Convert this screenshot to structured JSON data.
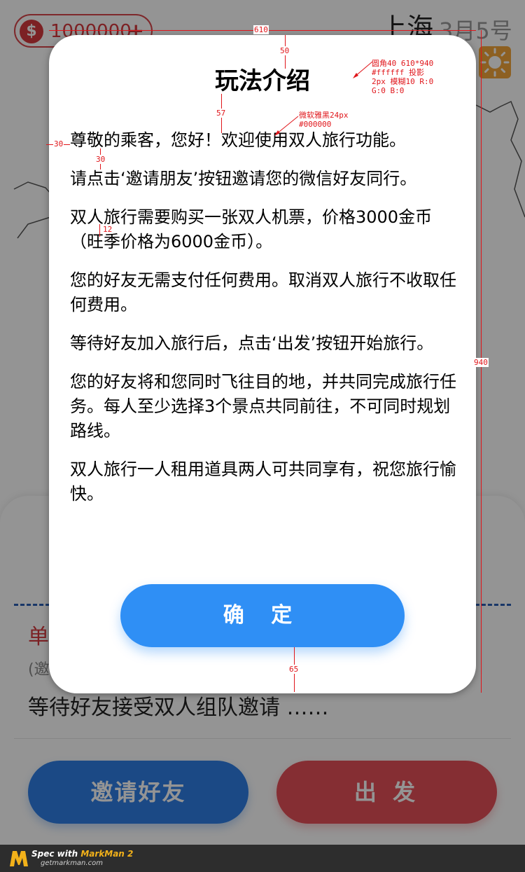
{
  "header": {
    "coin_symbol": "$",
    "coin_amount": "1000000",
    "coin_plus": "+",
    "city": "上海",
    "date": "3月5号"
  },
  "icons": {
    "weather": "sun-icon",
    "coin": "dollar-icon",
    "logo": "markman-logo"
  },
  "panel": {
    "mode_label": "单",
    "mode_sub": "(邀",
    "waiting_text": "等待好友接受双人组队邀请 ……",
    "invite_button": "邀请好友",
    "depart_button": "出 发"
  },
  "modal": {
    "title": "玩法介绍",
    "paragraphs": [
      "尊敬的乘客，您好！欢迎使用双人旅行功能。",
      "请点击‘邀请朋友’按钮邀请您的微信好友同行。",
      "双人旅行需要购买一张双人机票，价格3000金币（旺季价格为6000金币）。",
      "您的好友无需支付任何费用。取消双人旅行不收取任何费用。",
      "等待好友加入旅行后，点击‘出发’按钮开始旅行。",
      "您的好友将和您同时飞往目的地，并共同完成旅行任务。每人至少选择3个景点共同前往，不可同时规划路线。",
      "双人旅行一人租用道具两人可共同享有，祝您旅行愉快。"
    ],
    "confirm_button": "确 定"
  },
  "annotations": {
    "w610": "610",
    "h940": "940",
    "m50": "50",
    "m57": "57",
    "pad30": "30",
    "gap30": "30",
    "gap12": "12",
    "m65": "65",
    "spec_box": [
      "圆角40 610*940",
      "#ffffff 投影",
      "2px 模糊10 R:0",
      "G:0 B:0"
    ],
    "spec_font": [
      "微软雅黑24px",
      "#000000"
    ]
  },
  "colors": {
    "accent_blue": "#2f8ff5",
    "accent_red": "#e65058",
    "annotation_red": "#e0161b",
    "overlay": "rgba(0,0,0,0.42)"
  },
  "footer": {
    "spec_with": "Spec with ",
    "brand": "MarkMan 2",
    "url": "getmarkman.com"
  }
}
